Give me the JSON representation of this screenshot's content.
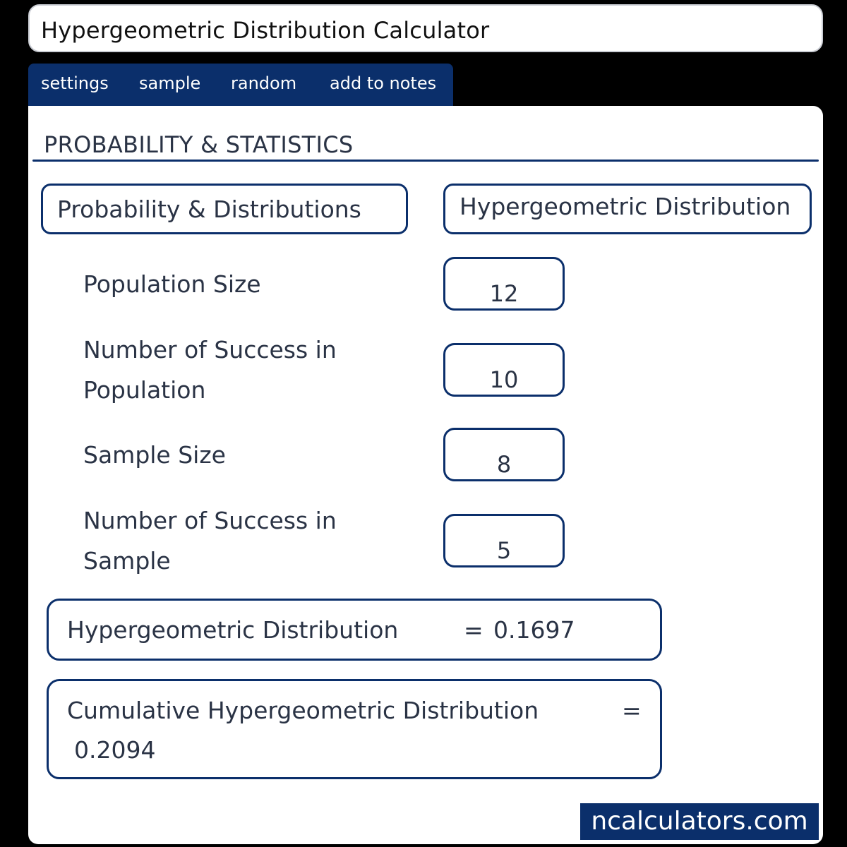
{
  "window": {
    "title": "Hypergeometric Distribution Calculator"
  },
  "toolbar": {
    "items": [
      "settings",
      "sample",
      "random",
      "add to notes"
    ]
  },
  "category": "PROBABILITY & STATISTICS",
  "selects": {
    "topic": "Probability & Distributions",
    "calculator": "Hypergeometric Distribution"
  },
  "inputs": [
    {
      "label": "Population Size",
      "value": "12"
    },
    {
      "label": "Number of Success in Population",
      "value": "10"
    },
    {
      "label": "Sample Size",
      "value": "8"
    },
    {
      "label": "Number of Success in Sample",
      "value": "5"
    }
  ],
  "results": [
    {
      "label": "Hypergeometric Distribution",
      "sep": "=",
      "value": "0.1697"
    },
    {
      "label": "Cumulative Hypergeometric Distribution",
      "sep": "=",
      "value": "0.2094"
    }
  ],
  "brand": "ncalculators.com",
  "colors": {
    "accent": "#0b2f6b",
    "background": "#000000",
    "panel": "#ffffff"
  }
}
